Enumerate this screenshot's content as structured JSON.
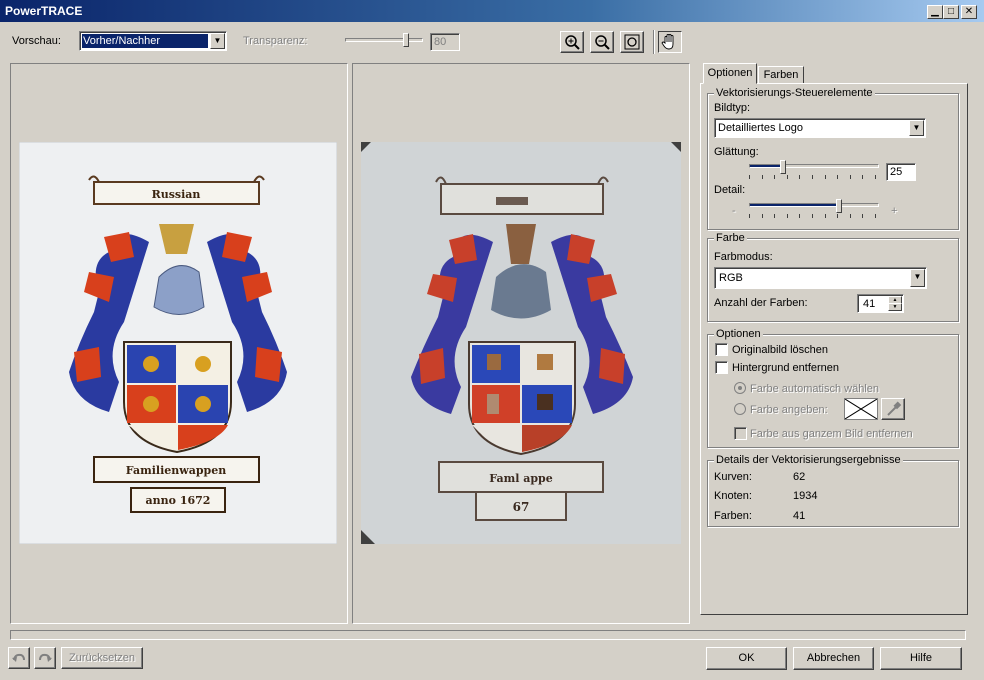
{
  "window": {
    "title": "PowerTRACE"
  },
  "toolbar": {
    "preview_label": "Vorschau:",
    "preview_value": "Vorher/Nachher",
    "transparency_label": "Transparenz:",
    "transparency_value": "80",
    "transparency_level": 0.8
  },
  "tabs": [
    {
      "label": "Optionen"
    },
    {
      "label": "Farben"
    }
  ],
  "vectorize": {
    "group_title": "Vektorisierungs-Steuerelemente",
    "image_type_label": "Bildtyp:",
    "image_type_value": "Detailliertes Logo",
    "smoothing_label": "Glättung:",
    "smoothing_value": "25",
    "detail_label": "Detail:",
    "detail_minus": "-",
    "detail_plus": "+",
    "detail_level": 0.7
  },
  "color": {
    "group_title": "Farbe",
    "mode_label": "Farbmodus:",
    "mode_value": "RGB",
    "count_label": "Anzahl der Farben:",
    "count_value": "41"
  },
  "options": {
    "group_title": "Optionen",
    "delete_original": "Originalbild löschen",
    "remove_background": "Hintergrund entfernen",
    "auto_color": "Farbe automatisch wählen",
    "specify_color": "Farbe angeben:",
    "remove_from_image": "Farbe aus ganzem Bild entfernen"
  },
  "results": {
    "group_title": "Details der Vektorisierungsergebnisse",
    "rows": [
      {
        "label": "Kurven:",
        "value": "62"
      },
      {
        "label": "Knoten:",
        "value": "1934"
      },
      {
        "label": "Farben:",
        "value": "41"
      }
    ]
  },
  "artwork": {
    "original_banner_top": "Russian",
    "original_banner_bottom": "Familienwappen",
    "original_year": "anno 1672",
    "traced_banner_bottom": "Faml    appe",
    "traced_year": "67"
  },
  "footer": {
    "reset_label": "Zurücksetzen",
    "ok_label": "OK",
    "cancel_label": "Abbrechen",
    "help_label": "Hilfe"
  },
  "colors": {
    "titlebar": "#0a246a",
    "face": "#d4d0c8",
    "selection": "#0a246a"
  }
}
